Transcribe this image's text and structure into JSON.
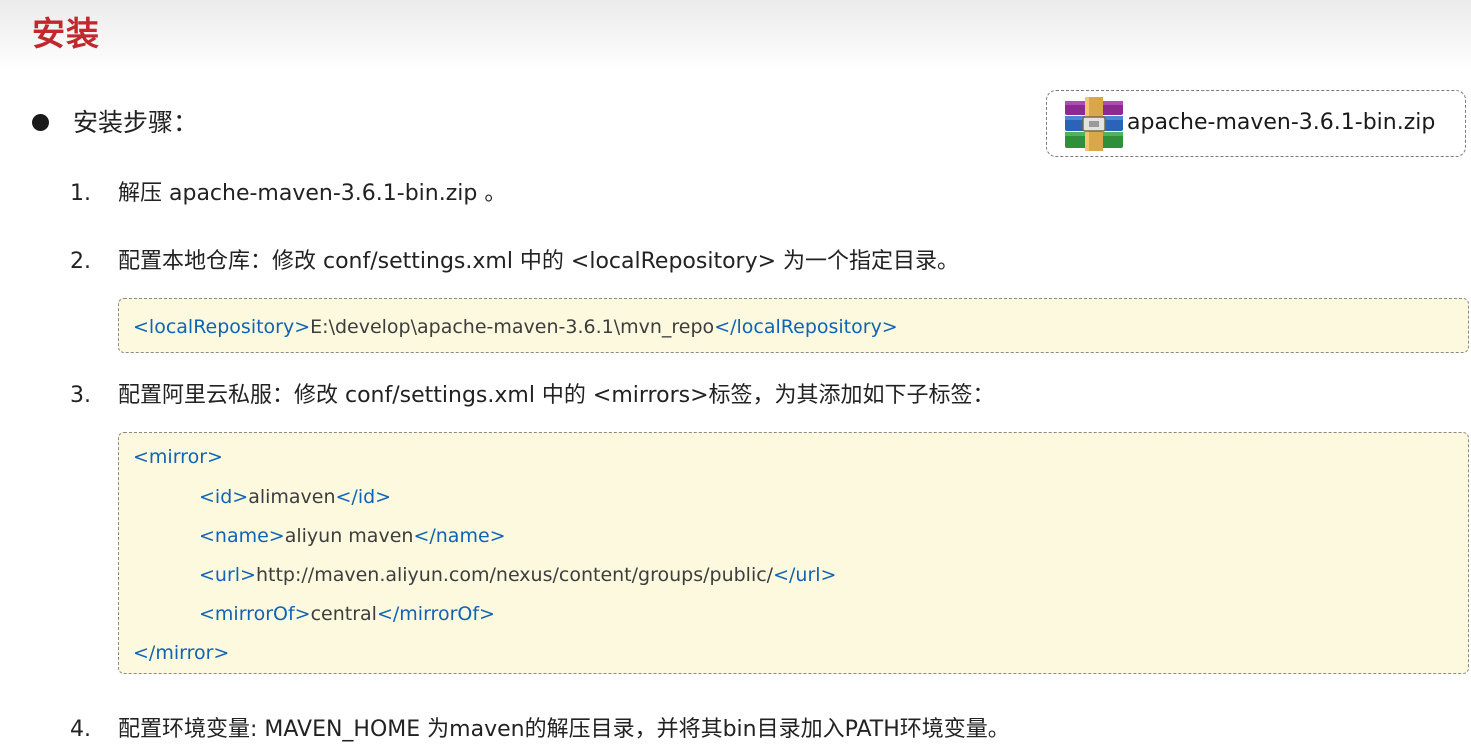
{
  "page": {
    "title": "安装"
  },
  "bullet": {
    "text": "安装步骤："
  },
  "download": {
    "filename": "apache-maven-3.6.1-bin.zip",
    "icon": "winrar-archive-icon"
  },
  "steps": [
    {
      "number": "1.",
      "text": "解压 apache-maven-3.6.1-bin.zip 。"
    },
    {
      "number": "2.",
      "text": "配置本地仓库：修改 conf/settings.xml 中的 <localRepository> 为一个指定目录。"
    },
    {
      "number": "3.",
      "text": "配置阿里云私服：修改 conf/settings.xml 中的 <mirrors>标签，为其添加如下子标签："
    },
    {
      "number": "4.",
      "text": "配置环境变量: MAVEN_HOME 为maven的解压目录，并将其bin目录加入PATH环境变量。"
    }
  ],
  "code_local_repo": {
    "open_tag": "<localRepository>",
    "value": "E:\\develop\\apache-maven-3.6.1\\mvn_repo",
    "close_tag": "</localRepository>"
  },
  "code_mirror": {
    "open": "<mirror>",
    "id_open": "<id>",
    "id_value": "alimaven",
    "id_close": "</id>",
    "name_open": "<name>",
    "name_value": "aliyun maven",
    "name_close": "</name>",
    "url_open": "<url>",
    "url_value": "http://maven.aliyun.com/nexus/content/groups/public/",
    "url_close": "</url>",
    "mirrorof_open": "<mirrorOf>",
    "mirrorof_value": "central",
    "mirrorof_close": "</mirrorOf>",
    "close": "</mirror>"
  },
  "colors": {
    "title": "#c0282d",
    "xml_tag": "#0f63b4",
    "code_background": "#fdf9df"
  }
}
